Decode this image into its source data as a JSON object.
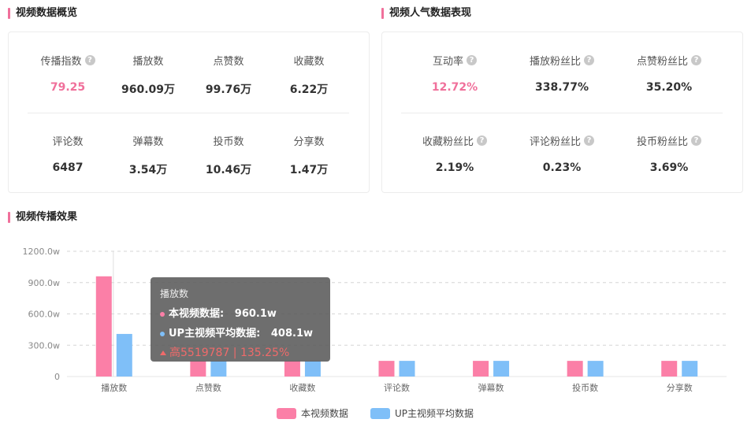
{
  "overview": {
    "title": "视频数据概览",
    "row1": [
      {
        "label": "传播指数",
        "value": "79.25",
        "help": true,
        "highlight": true
      },
      {
        "label": "播放数",
        "value": "960.09万",
        "help": false,
        "highlight": false
      },
      {
        "label": "点赞数",
        "value": "99.76万",
        "help": false,
        "highlight": false
      },
      {
        "label": "收藏数",
        "value": "6.22万",
        "help": false,
        "highlight": false
      }
    ],
    "row2": [
      {
        "label": "评论数",
        "value": "6487"
      },
      {
        "label": "弹幕数",
        "value": "3.54万"
      },
      {
        "label": "投币数",
        "value": "10.46万"
      },
      {
        "label": "分享数",
        "value": "1.47万"
      }
    ]
  },
  "popularity": {
    "title": "视频人气数据表现",
    "row1": [
      {
        "label": "互动率",
        "value": "12.72%",
        "highlight": true
      },
      {
        "label": "播放粉丝比",
        "value": "338.77%",
        "highlight": false
      },
      {
        "label": "点赞粉丝比",
        "value": "35.20%",
        "highlight": false
      }
    ],
    "row2": [
      {
        "label": "收藏粉丝比",
        "value": "2.19%"
      },
      {
        "label": "评论粉丝比",
        "value": "0.23%"
      },
      {
        "label": "投币粉丝比",
        "value": "3.69%"
      }
    ]
  },
  "spread": {
    "title": "视频传播效果"
  },
  "colors": {
    "accent": "#f0709b",
    "series_this": "#fb7fa7",
    "series_avg": "#7fbff8"
  },
  "chart_data": {
    "type": "bar",
    "categories": [
      "播放数",
      "点赞数",
      "收藏数",
      "评论数",
      "弹幕数",
      "投币数",
      "分享数"
    ],
    "y_ticks": [
      "0",
      "300.0w",
      "600.0w",
      "900.0w",
      "1200.0w"
    ],
    "ylim": [
      0,
      1200
    ],
    "grid": true,
    "legend_position": "bottom-center",
    "series": [
      {
        "name": "本视频数据",
        "values": [
          960.1,
          150,
          150,
          150,
          150,
          150,
          150
        ]
      },
      {
        "name": "UP主视频平均数据",
        "values": [
          408.1,
          150,
          150,
          150,
          150,
          150,
          150
        ]
      }
    ]
  },
  "tooltip": {
    "title": "播放数",
    "row1_label": "本视频数据:",
    "row1_value": "960.1w",
    "row2_label": "UP主视频平均数据:",
    "row2_value": "408.1w",
    "diff": "高5519787 | 135.25%"
  },
  "legend": {
    "this_label": "本视频数据",
    "avg_label": "UP主视频平均数据"
  }
}
